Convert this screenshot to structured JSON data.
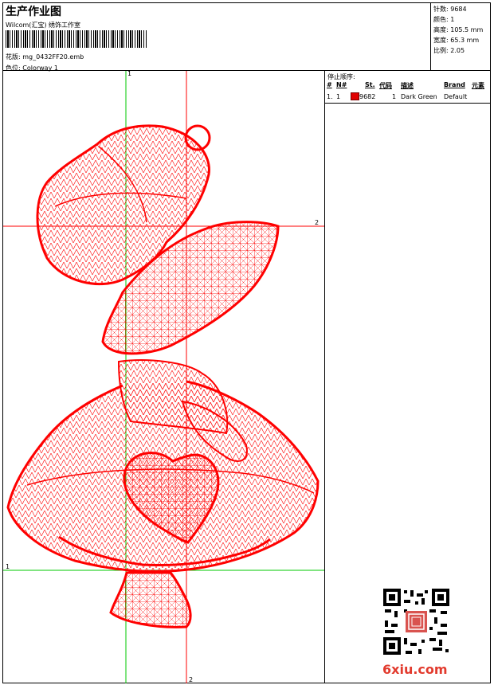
{
  "header": {
    "title": "生产作业图",
    "company": "Wilcom(汇宝) 绣饰工作室",
    "design_label": "花版:",
    "design_value": "mg_0432FF20.emb",
    "colorway_label": "色位:",
    "colorway_value": "Colorway 1"
  },
  "stats": {
    "stitches": "针数: 9684",
    "colors": "颜色: 1",
    "height": "高度: 105.5 mm",
    "width": "宽度: 65.3 mm",
    "scale": "比例: 2.05"
  },
  "stop_sequence": {
    "title": "停止顺序:",
    "headers": [
      "#",
      "N#",
      "St.",
      "代码",
      "描述",
      "Brand",
      "元素"
    ],
    "rows": [
      {
        "num": "1.",
        "needle": "1",
        "stitches": "9682",
        "code": "1",
        "description": "Dark Green",
        "brand": "Default",
        "swatch_color": "#e00000"
      }
    ]
  },
  "guides": {
    "v1": "1",
    "v2": "2",
    "h1": "1",
    "h2": "2"
  },
  "watermark": {
    "text": "6xiu.com",
    "color": "#e23b2e"
  },
  "colors": {
    "stitch": "#ff0000",
    "guide_green": "#00c800",
    "guide_red": "#ff0000"
  }
}
